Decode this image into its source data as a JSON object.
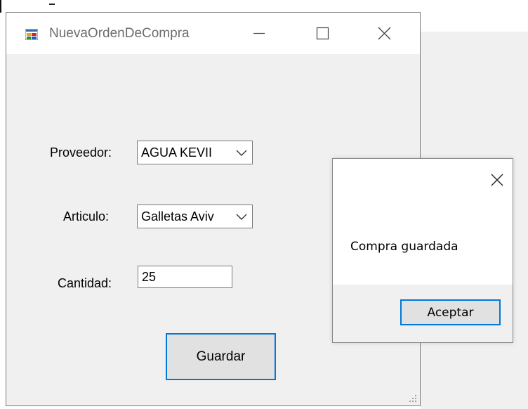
{
  "main_window": {
    "title": "NuevaOrdenDeCompra",
    "icon": "windows-form-icon",
    "proveedor": {
      "label": "Proveedor:",
      "value": "AGUA KEVII"
    },
    "articulo": {
      "label": "Articulo:",
      "value": "Galletas Aviv"
    },
    "cantidad": {
      "label": "Cantidad:",
      "value": "25"
    },
    "save_button": "Guardar"
  },
  "message_box": {
    "text": "Compra guardada",
    "ok_button": "Aceptar"
  },
  "colors": {
    "focus_border": "#0078d7",
    "window_bg": "#f0f0f0",
    "titlebar_bg": "#ffffff"
  }
}
